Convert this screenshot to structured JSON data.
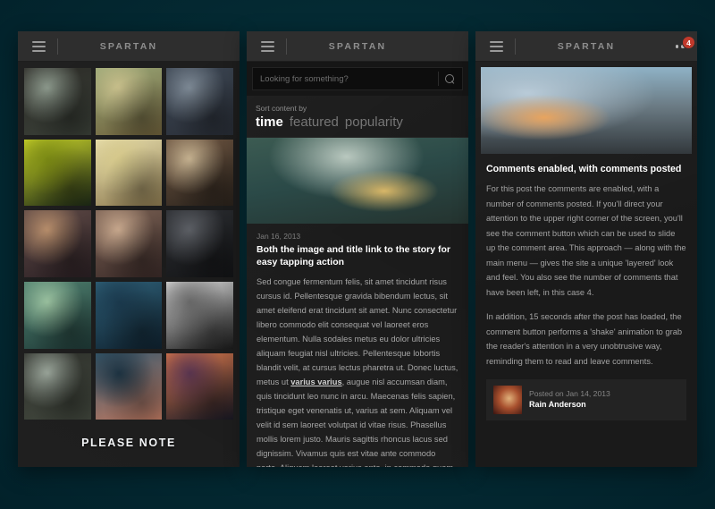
{
  "app": {
    "brand": "SPARTAN",
    "background_color": "#042a33",
    "panel_color": "#171717",
    "topbar_color": "#2e2e2e",
    "badge_color": "#c0392b"
  },
  "panel1": {
    "name": "gallery-grid-screen",
    "brand": "SPARTAN",
    "menu_icon": "hamburger-icon",
    "footer_note": "PLEASE NOTE",
    "thumbnails": [
      {
        "alt": "bridge-with-horse",
        "c1": "#2b2a26",
        "c2": "#8d9a8d",
        "c3": "#3a4038"
      },
      {
        "alt": "autumn-landscape",
        "c1": "#9aa878",
        "c2": "#c9c08c",
        "c3": "#6d5f3a"
      },
      {
        "alt": "burning-city-skyline",
        "c1": "#3c4653",
        "c2": "#7e8a96",
        "c3": "#2a2f38"
      },
      {
        "alt": "green-forest-warrior",
        "c1": "#c9d32a",
        "c2": "#7b8a14",
        "c3": "#1d2a16"
      },
      {
        "alt": "blonde-girl-portrait",
        "c1": "#e8dfae",
        "c2": "#d6c98b",
        "c3": "#8d7a4f"
      },
      {
        "alt": "female-warrior-cloak",
        "c1": "#6d5541",
        "c2": "#c7b391",
        "c3": "#2c241d"
      },
      {
        "alt": "warrior-woman-sword",
        "c1": "#5f4a46",
        "c2": "#b98f6c",
        "c3": "#2b2024"
      },
      {
        "alt": "redhead-woman-seated",
        "c1": "#7a6153",
        "c2": "#c9a98e",
        "c3": "#3a2a28"
      },
      {
        "alt": "bearded-man-dark",
        "c1": "#2b2d31",
        "c2": "#5d6066",
        "c3": "#141517"
      },
      {
        "alt": "figure-on-cliff",
        "c1": "#4f7f6e",
        "c2": "#9bc2a0",
        "c3": "#1f3b38"
      },
      {
        "alt": "hand-reaching-water",
        "c1": "#2f6077",
        "c2": "#1b3a4e",
        "c3": "#0f2230"
      },
      {
        "alt": "black-and-white-sketch",
        "c1": "#d9d9d9",
        "c2": "#6a6a6a",
        "c3": "#1c1c1c"
      },
      {
        "alt": "bridge-landscape-night",
        "c1": "#2d2f2a",
        "c2": "#9aa59a",
        "c3": "#42483e"
      },
      {
        "alt": "man-with-pipe-caricature",
        "c1": "#35576b",
        "c2": "#1d3342",
        "c3": "#c07a62"
      },
      {
        "alt": "sunset-silhouette",
        "c1": "#d8774a",
        "c2": "#5a3550",
        "c3": "#1a1a26"
      }
    ]
  },
  "panel2": {
    "name": "feed-screen",
    "brand": "SPARTAN",
    "menu_icon": "hamburger-icon",
    "search": {
      "placeholder": "Looking for something?",
      "value": "",
      "icon": "search-icon"
    },
    "sort": {
      "label": "Sort content by",
      "options": [
        "time",
        "featured",
        "popularity"
      ],
      "active": "time"
    },
    "post": {
      "hero_alt": "man-climbing-toward-city",
      "date": "Jan 16, 2013",
      "title": "Both the image and title link to the story for easy tapping action",
      "body_before_link": "Sed congue fermentum felis, sit amet tincidunt risus cursus id. Pellentesque gravida bibendum lectus, sit amet eleifend erat tincidunt sit amet. Nunc consectetur libero commodo elit consequat vel laoreet eros elementum. Nulla sodales metus eu dolor ultricies aliquam feugiat nisl ultricies. Pellentesque lobortis blandit velit, at cursus lectus pharetra ut. Donec luctus, metus ut ",
      "link_text": "varius varius",
      "body_after_link": ", augue nisl accumsan diam, quis tincidunt leo nunc in arcu. Maecenas felis sapien, tristique eget venenatis ut, varius at sem. Aliquam vel velit id sem laoreet volutpat id vitae risus. Phasellus mollis lorem justo. Mauris sagittis rhoncus lacus sed dignissim. Vivamus quis est vitae ante commodo porta. Aliquam laoreet varius ante, in commodo quam"
    }
  },
  "panel3": {
    "name": "post-detail-screen",
    "brand": "SPARTAN",
    "menu_icon": "hamburger-icon",
    "comment_button_icon": "ellipsis-icon",
    "comment_count": "4",
    "hero_alt": "burning-city-with-flag",
    "title": "Comments enabled, with comments posted",
    "paragraphs": [
      "For this post the comments are enabled, with a number of comments posted. If you'll direct your attention to the upper right corner of the screen, you'll see the comment button which can be used to slide up the comment area. This approach — along with the main menu — gives the site a unique 'layered' look and feel. You also see the number of comments that have been left, in this case 4.",
      "In addition, 15 seconds after the post has loaded, the comment button performs a 'shake' animation to grab the reader's attention in a very unobtrusive way, reminding them to read and leave comments."
    ],
    "author": {
      "avatar_alt": "lion-avatar",
      "posted_on": "Posted on Jan 14, 2013",
      "name": "Rain Anderson"
    }
  }
}
